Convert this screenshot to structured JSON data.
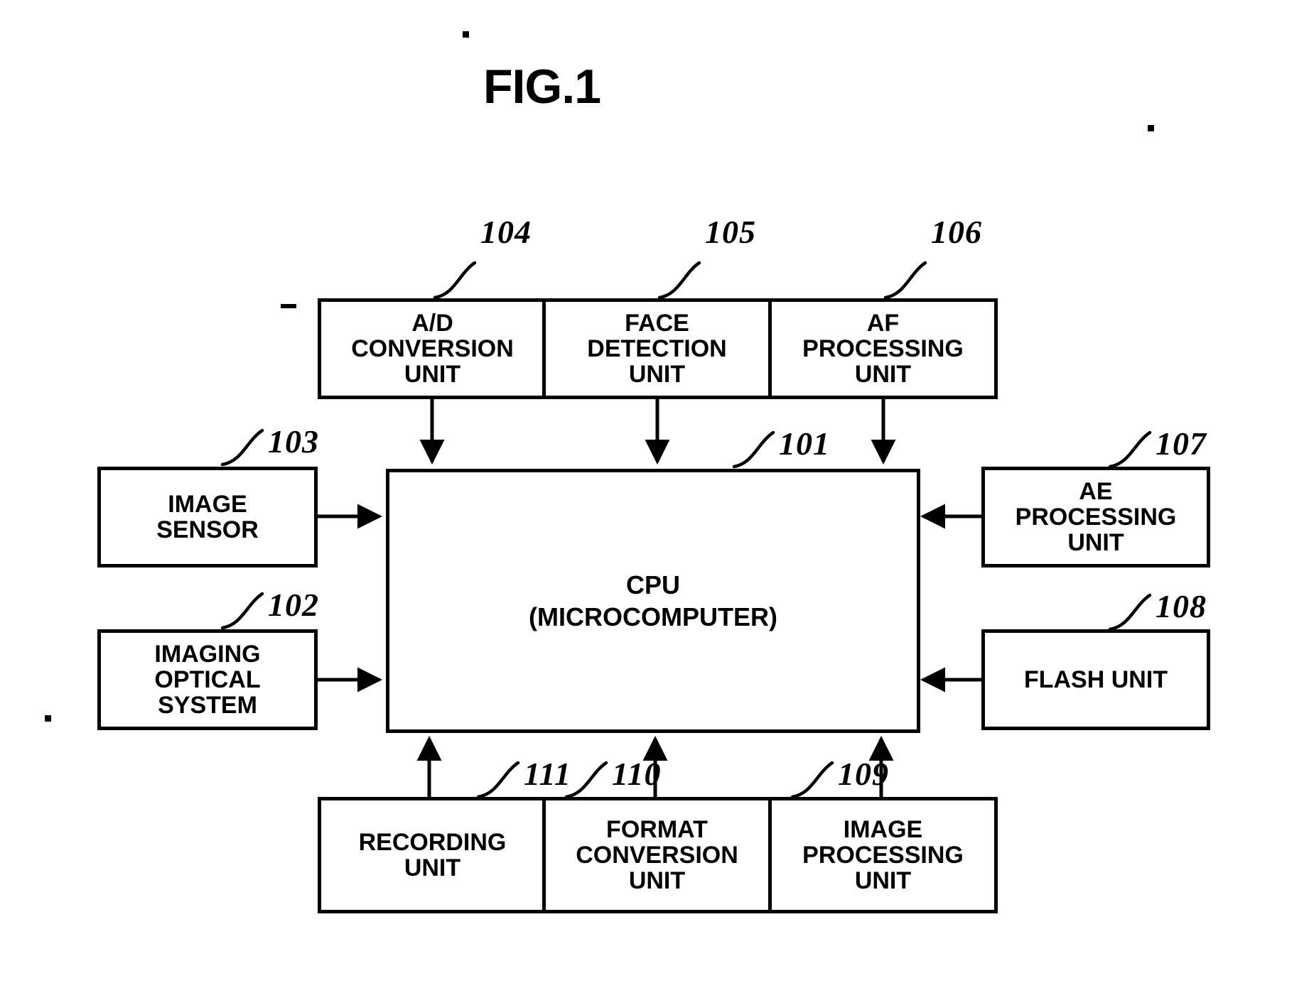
{
  "figure": {
    "title": "FIG.1",
    "type": "block-diagram",
    "description": "Imaging apparatus block diagram centered on a CPU (microcomputer)"
  },
  "blocks": [
    {
      "id": "101",
      "ref": "101",
      "label": "CPU\n(MICROCOMPUTER)"
    },
    {
      "id": "102",
      "ref": "102",
      "label": "IMAGING\nOPTICAL\nSYSTEM"
    },
    {
      "id": "103",
      "ref": "103",
      "label": "IMAGE\nSENSOR"
    },
    {
      "id": "104",
      "ref": "104",
      "label": "A/D\nCONVERSION\nUNIT"
    },
    {
      "id": "105",
      "ref": "105",
      "label": "FACE\nDETECTION\nUNIT"
    },
    {
      "id": "106",
      "ref": "106",
      "label": "AF\nPROCESSING\nUNIT"
    },
    {
      "id": "107",
      "ref": "107",
      "label": "AE\nPROCESSING\nUNIT"
    },
    {
      "id": "108",
      "ref": "108",
      "label": "FLASH UNIT"
    },
    {
      "id": "109",
      "ref": "109",
      "label": "IMAGE\nPROCESSING\nUNIT"
    },
    {
      "id": "110",
      "ref": "110",
      "label": "FORMAT\nCONVERSION\nUNIT"
    },
    {
      "id": "111",
      "ref": "111",
      "label": "RECORDING\nUNIT"
    }
  ],
  "connections": [
    {
      "from": "104",
      "to": "101",
      "direction": "down"
    },
    {
      "from": "105",
      "to": "101",
      "direction": "down"
    },
    {
      "from": "106",
      "to": "101",
      "direction": "down"
    },
    {
      "from": "103",
      "to": "101",
      "direction": "right"
    },
    {
      "from": "102",
      "to": "101",
      "direction": "right"
    },
    {
      "from": "107",
      "to": "101",
      "direction": "left"
    },
    {
      "from": "108",
      "to": "101",
      "direction": "left"
    },
    {
      "from": "111",
      "to": "101",
      "direction": "up"
    },
    {
      "from": "110",
      "to": "101",
      "direction": "up"
    },
    {
      "from": "109",
      "to": "101",
      "direction": "up"
    }
  ],
  "colors": {
    "ink": "#000000",
    "paper": "#ffffff"
  }
}
